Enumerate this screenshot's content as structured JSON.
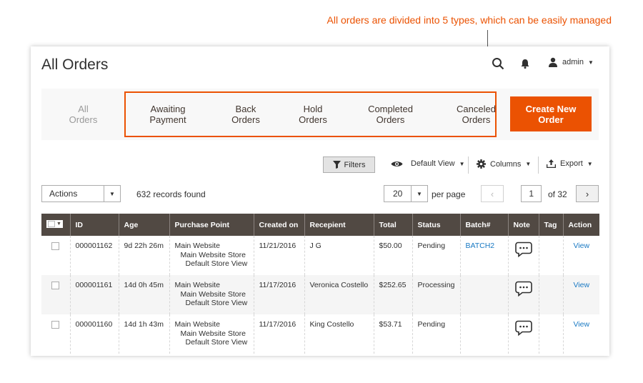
{
  "annotation": "All orders are divided into 5 types, which can be easily managed",
  "header": {
    "title": "All Orders",
    "user": "admin"
  },
  "tabs": [
    {
      "line1": "All",
      "line2": "Orders"
    },
    {
      "line1": "Awaiting",
      "line2": "Payment"
    },
    {
      "line1": "Back",
      "line2": "Orders"
    },
    {
      "line1": "Hold",
      "line2": "Orders"
    },
    {
      "line1": "Completed",
      "line2": "Orders"
    },
    {
      "line1": "Canceled",
      "line2": "Orders"
    }
  ],
  "create_button": {
    "line1": "Create New",
    "line2": "Order"
  },
  "toolbar": {
    "filters": "Filters",
    "view": "Default View",
    "columns": "Columns",
    "export": "Export"
  },
  "actions": {
    "label": "Actions",
    "records": "632 records found"
  },
  "pagination": {
    "per_page": "20",
    "per_page_label": "per page",
    "current_page": "1",
    "of_pages": "of 32"
  },
  "columns": [
    "ID",
    "Age",
    "Purchase Point",
    "Created on",
    "Recepient",
    "Total",
    "Status",
    "Batch#",
    "Note",
    "Tag",
    "Action"
  ],
  "rows": [
    {
      "id": "000001162",
      "age": "9d 22h 26m",
      "pp1": "Main Website",
      "pp2": "Main Website Store",
      "pp3": "Default Store View",
      "created": "11/21/2016",
      "recipient": "J G",
      "total": "$50.00",
      "status": "Pending",
      "batch": "BATCH2",
      "tag": "",
      "action": "View"
    },
    {
      "id": "000001161",
      "age": "14d 0h 45m",
      "pp1": "Main Website",
      "pp2": "Main Website Store",
      "pp3": "Default Store View",
      "created": "11/17/2016",
      "recipient": "Veronica Costello",
      "total": "$252.65",
      "status": "Processing",
      "batch": "",
      "tag": "",
      "action": "View"
    },
    {
      "id": "000001160",
      "age": "14d 1h 43m",
      "pp1": "Main Website",
      "pp2": "Main Website Store",
      "pp3": "Default Store View",
      "created": "11/17/2016",
      "recipient": "King Costello",
      "total": "$53.71",
      "status": "Pending",
      "batch": "",
      "tag": "",
      "action": "View"
    }
  ],
  "colors": {
    "accent": "#eb5202",
    "header_bg": "#514943",
    "link": "#1979c3"
  }
}
